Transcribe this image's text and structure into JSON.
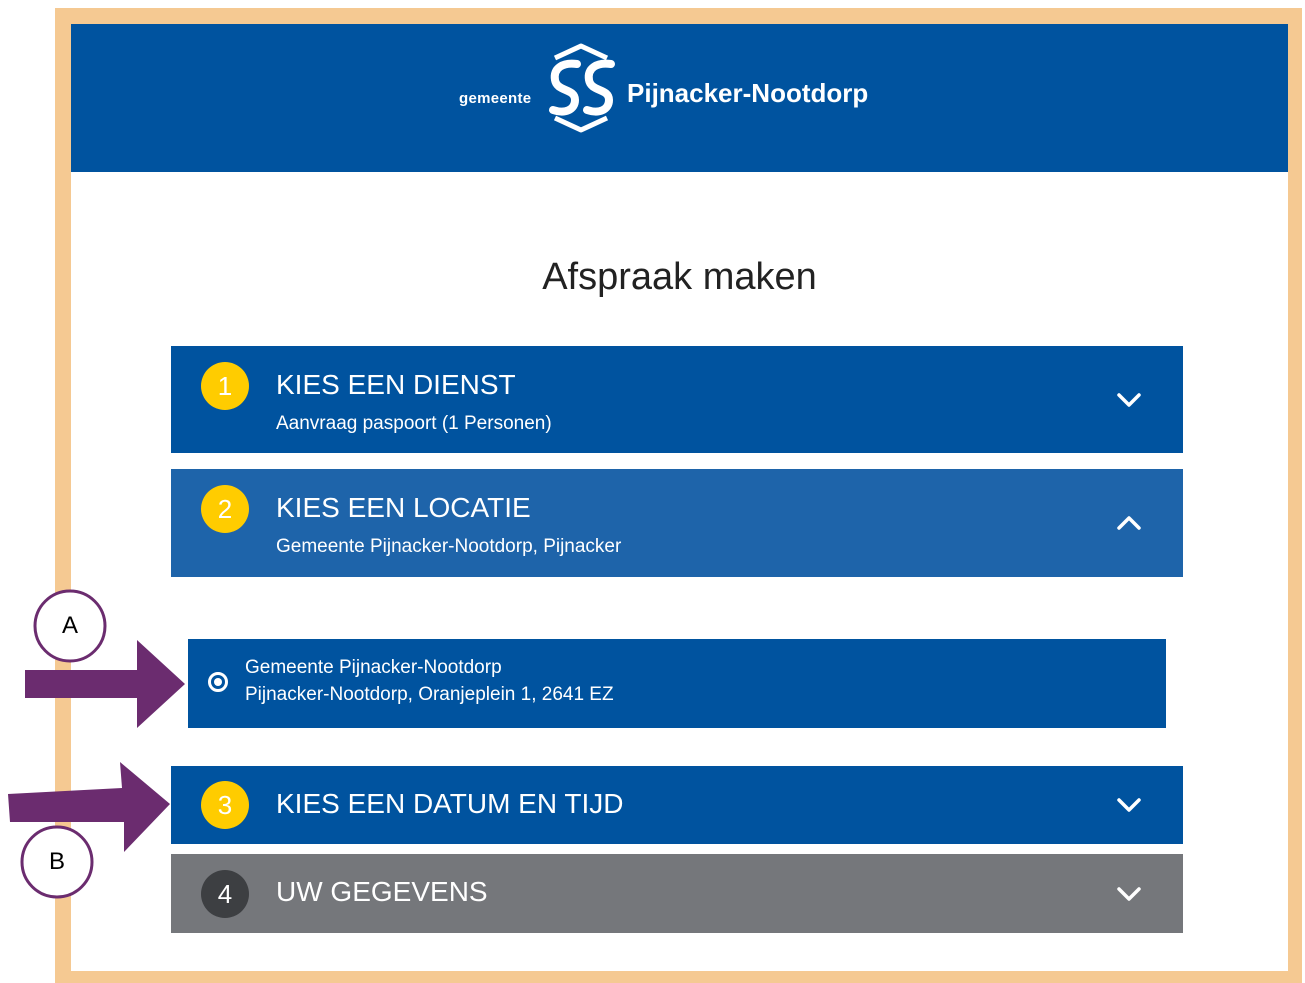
{
  "header": {
    "logo_prefix": "gemeente",
    "logo_name": "Pijnacker-Nootdorp",
    "logo_icon": "municipality-logo-icon",
    "background": "#00539f"
  },
  "page_title": "Afspraak maken",
  "steps": [
    {
      "number": "1",
      "title": "KIES EEN DIENST",
      "subtitle": "Aanvraag paspoort (1 Personen)",
      "state": "completed",
      "icon": "chevron-down-icon"
    },
    {
      "number": "2",
      "title": "KIES EEN LOCATIE",
      "subtitle": "Gemeente Pijnacker-Nootdorp, Pijnacker",
      "state": "expanded",
      "icon": "chevron-up-icon"
    },
    {
      "number": "3",
      "title": "KIES EEN DATUM EN TIJD",
      "subtitle": "",
      "state": "collapsed",
      "icon": "chevron-down-icon"
    },
    {
      "number": "4",
      "title": "UW GEGEVENS",
      "subtitle": "",
      "state": "disabled",
      "icon": "chevron-down-icon"
    }
  ],
  "location_option": {
    "name": "Gemeente Pijnacker-Nootdorp",
    "address": "Pijnacker-Nootdorp, Oranjeplein 1, 2641 EZ",
    "selected": true
  },
  "annotations": [
    {
      "label": "A",
      "icon": "arrow-right-icon"
    },
    {
      "label": "B",
      "icon": "arrow-right-icon"
    }
  ],
  "colors": {
    "brand_blue": "#00539f",
    "active_blue": "#1e64aa",
    "step_badge": "#ffcc00",
    "disabled_gray": "#75777b",
    "frame": "#f5c992",
    "annotation_purple": "#6b2c6f"
  }
}
